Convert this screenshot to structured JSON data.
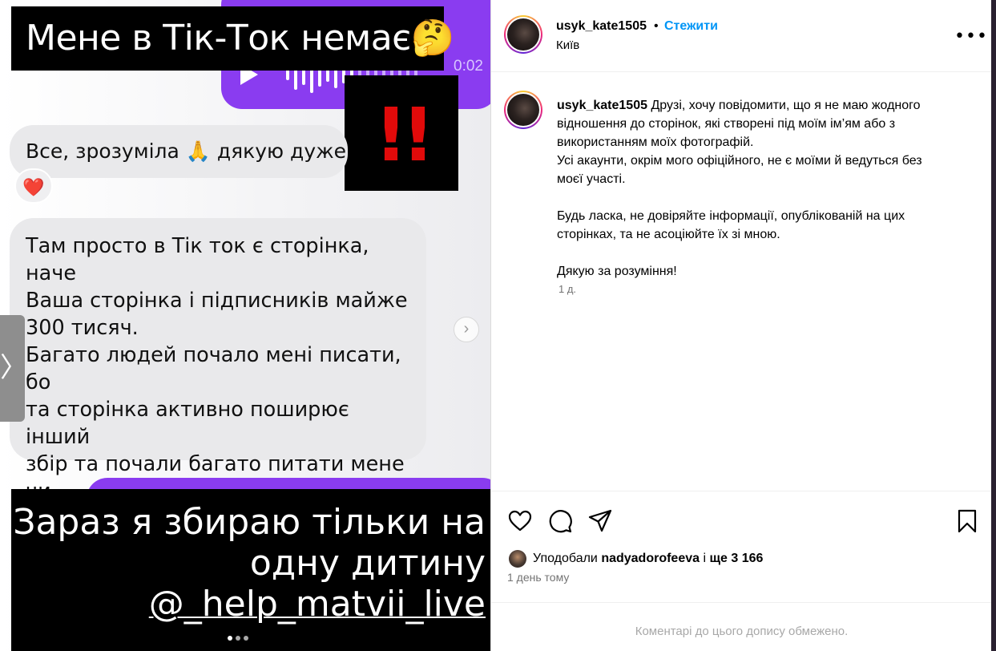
{
  "media": {
    "top_caption": "Мене в Тік-Ток немає🤔",
    "alert_mark": "!!",
    "voice_time": "0:02",
    "bubble_1": "Все, зрозуміла 🙏 дякую дуже",
    "reaction": "❤️",
    "bubble_2": "Там просто в Тік ток є сторінка, наче\nВаша сторінка і підписників майже\n300 тисяч.\nБагато людей почало мені писати, бо\nта сторінка активно поширює інший\nзбір та почали багато питати мене чи\nшось сталось, чи Ви нас більше не\nпідтримуєте 🙏",
    "bottom_caption_line1": "Зараз я збираю тільки на",
    "bottom_caption_line2": "одну дитину",
    "bottom_caption_handle": "@_help_matvii_live",
    "next_arrow": "›",
    "prev_arrow": "〉",
    "slides": 3,
    "active_slide": 1
  },
  "header": {
    "username": "usyk_kate1505",
    "separator": "•",
    "follow_label": "Стежити",
    "location": "Київ",
    "more_icon": "more-horizontal-icon",
    "more_glyph": "•••"
  },
  "caption": {
    "username": "usyk_kate1505",
    "lines": [
      "Друзі, хочу повідомити, що я не маю жодного",
      "відношення до сторінок, які створені під моїм ім’ям або з",
      "використанням моїх фотографій.",
      "Усі акаунти, окрім мого офіційного, не є моїми й ведуться без",
      "моєї участі."
    ],
    "lines_2": [
      "Будь ласка, не довіряйте інформації, опублікованій на цих",
      "сторінках, та не асоціюйте їх зі мною."
    ],
    "lines_3": [
      "Дякую за розуміння!"
    ],
    "time": "1 д."
  },
  "likes": {
    "prefix": "Уподобали",
    "user": "nadyadorofeeva",
    "middle": "і",
    "rest": "ще 3 166"
  },
  "post_date": "1 день тому",
  "comments_disabled": "Коментарі до цього допису обмежено.",
  "colors": {
    "accent": "#0095f6",
    "purple_bubble": "#8a3cf0",
    "alert_red": "#e10a0a"
  }
}
